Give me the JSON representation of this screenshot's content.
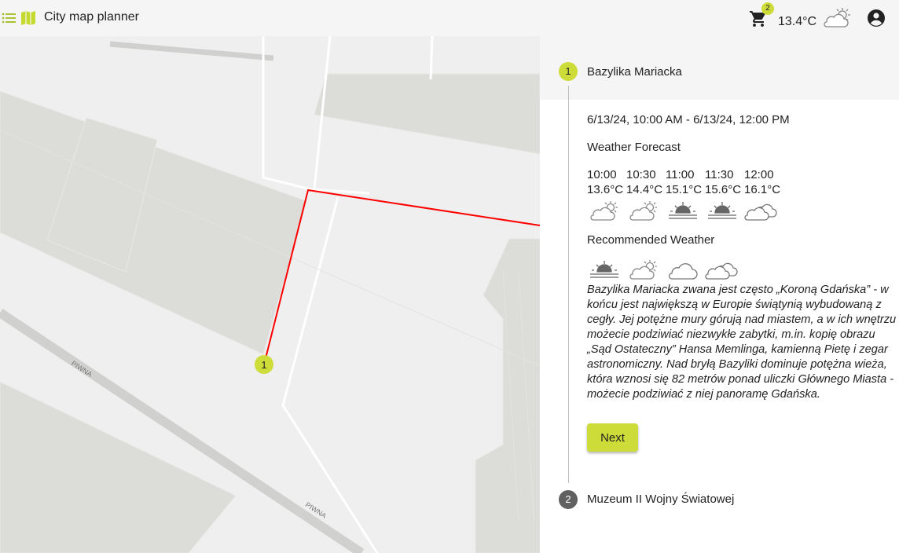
{
  "header": {
    "app_title": "City map planner",
    "cart_count": "2",
    "temperature": "13.4°C",
    "icons": [
      "menu-icon",
      "map-icon",
      "cart-icon",
      "partly-cloudy-icon",
      "account-circle-icon"
    ]
  },
  "map": {
    "street_labels": [
      "PIWNA",
      "PIWNA"
    ],
    "marker_label": "1",
    "route_color": "#ff0000",
    "marker_color": "#cddc39"
  },
  "stepper": {
    "steps": [
      {
        "number": "1",
        "title": "Bazylika Mariacka",
        "dates": "6/13/24, 10:00 AM - 6/13/24, 12:00 PM",
        "forecast_title": "Weather Forecast",
        "forecast": [
          {
            "time": "10:00",
            "temp": "13.6°C",
            "icon": "partly-cloudy-icon"
          },
          {
            "time": "10:30",
            "temp": "14.4°C",
            "icon": "partly-cloudy-icon"
          },
          {
            "time": "11:00",
            "temp": "15.1°C",
            "icon": "sunrise-icon"
          },
          {
            "time": "11:30",
            "temp": "15.6°C",
            "icon": "sunrise-icon"
          },
          {
            "time": "12:00",
            "temp": "16.1°C",
            "icon": "cloudy-icon"
          }
        ],
        "recommended_title": "Recommended Weather",
        "recommended": [
          "sunrise-icon",
          "partly-cloudy-icon",
          "cloud-icon",
          "cloudy-icon"
        ],
        "description": "Bazylika Mariacka zwana jest często „Koroną Gdańska” - w końcu jest największą w Europie świątynią wybudowaną z cegły. Jej potężne mury górują nad miastem, a w ich wnętrzu możecie podziwiać niezwykłe zabytki, m.in. kopię obrazu „Sąd Ostateczny” Hansa Memlinga, kamienną Pietę i zegar astronomiczny. Nad bryłą Bazyliki dominuje potężna wieża, która wznosi się 82 metrów ponad uliczki Głównego Miasta - możecie podziwiać z niej panoramę Gdańska.",
        "next_label": "Next"
      },
      {
        "number": "2",
        "title": "Muzeum II Wojny Światowej"
      }
    ]
  },
  "colors": {
    "accent": "#cddc39",
    "inactive_step": "#616161",
    "toolbar_bg": "#f5f5f5"
  }
}
